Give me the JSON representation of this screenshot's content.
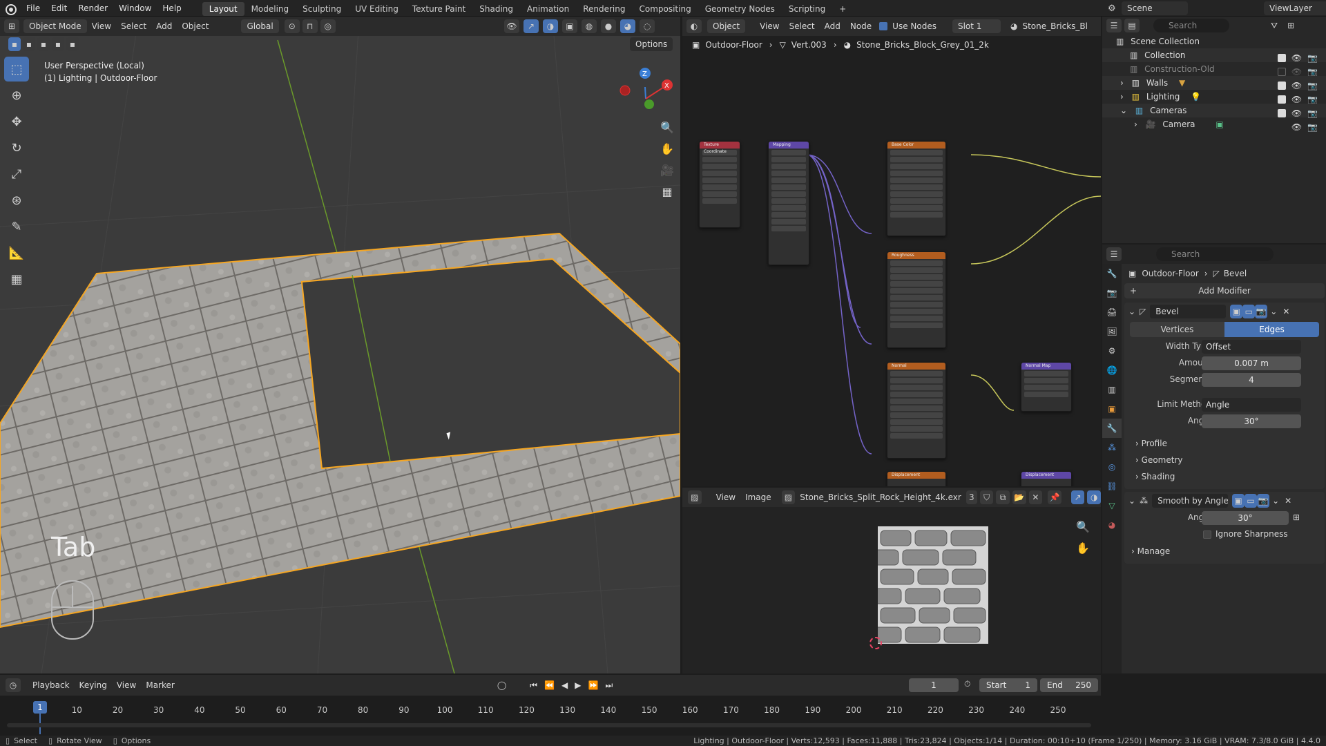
{
  "menu": [
    "File",
    "Edit",
    "Render",
    "Window",
    "Help"
  ],
  "workspaces": [
    "Layout",
    "Modeling",
    "Sculpting",
    "UV Editing",
    "Texture Paint",
    "Shading",
    "Animation",
    "Rendering",
    "Compositing",
    "Geometry Nodes",
    "Scripting"
  ],
  "active_workspace": "Layout",
  "top_right": {
    "scene": "Scene",
    "view_layer": "ViewLayer"
  },
  "viewport": {
    "mode": "Object Mode",
    "menus": [
      "View",
      "Select",
      "Add",
      "Object"
    ],
    "orientation": "Global",
    "options": "Options",
    "info_line1": "User Perspective (Local)",
    "info_line2": "(1) Lighting | Outdoor-Floor",
    "key_overlay": "Tab",
    "colors": {
      "bg": "#3b3b3b",
      "selection": "#f5a623"
    }
  },
  "node_editor": {
    "object_mode": "Object",
    "menus": [
      "View",
      "Select",
      "Add",
      "Node"
    ],
    "use_nodes_label": "Use Nodes",
    "slot": "Slot 1",
    "material": "Stone_Bricks_Bl",
    "breadcrumb": [
      "Outdoor-Floor",
      "Vert.003",
      "Stone_Bricks_Block_Grey_01_2k"
    ],
    "nodes": [
      "Texture Coordinate",
      "Mapping",
      "Base Color",
      "Roughness",
      "Normal",
      "Normal Map",
      "Displacement"
    ]
  },
  "image_editor": {
    "menus": [
      "View",
      "Image"
    ],
    "image_name": "Stone_Bricks_Split_Rock_Height_4k.exr",
    "users": "3"
  },
  "outliner": {
    "search_placeholder": "Search",
    "items": [
      {
        "label": "Scene Collection"
      },
      {
        "label": "Collection"
      },
      {
        "label": "Construction-Old"
      },
      {
        "label": "Walls"
      },
      {
        "label": "Lighting"
      },
      {
        "label": "Cameras"
      },
      {
        "label": "Camera"
      }
    ]
  },
  "properties": {
    "search_placeholder": "Search",
    "breadcrumb": [
      "Outdoor-Floor",
      "Bevel"
    ],
    "add_modifier": "Add Modifier",
    "bevel": {
      "name": "Bevel",
      "tab_vertices": "Vertices",
      "tab_edges": "Edges",
      "width_type_label": "Width Type",
      "width_type": "Offset",
      "amount_label": "Amount",
      "amount": "0.007 m",
      "segments_label": "Segments",
      "segments": "4",
      "limit_method_label": "Limit Method",
      "limit_method": "Angle",
      "angle_label": "Angle",
      "angle": "30°",
      "subpanels": [
        "Profile",
        "Geometry",
        "Shading"
      ]
    },
    "smooth": {
      "name": "Smooth by Angle",
      "angle_label": "Angle",
      "angle": "30°",
      "ignore_sharpness": "Ignore Sharpness",
      "manage": "Manage"
    }
  },
  "timeline": {
    "menus": [
      "Playback",
      "Keying",
      "View",
      "Marker"
    ],
    "current_frame": "1",
    "start_label": "Start",
    "start": "1",
    "end_label": "End",
    "end": "250",
    "ticks": [
      "1",
      "10",
      "20",
      "30",
      "40",
      "50",
      "60",
      "70",
      "80",
      "90",
      "100",
      "110",
      "120",
      "130",
      "140",
      "150",
      "160",
      "170",
      "180",
      "190",
      "200",
      "210",
      "220",
      "230",
      "240",
      "250"
    ]
  },
  "statusbar": {
    "left": [
      "Select",
      "Rotate View",
      "Options"
    ],
    "right": "Lighting | Outdoor-Floor | Verts:12,593 | Faces:11,888 | Tris:23,824 | Objects:1/14 | Duration: 00:10+10 (Frame 1/250) | Memory: 3.16 GiB | VRAM: 7.3/8.0 GiB | 4.4.0"
  }
}
